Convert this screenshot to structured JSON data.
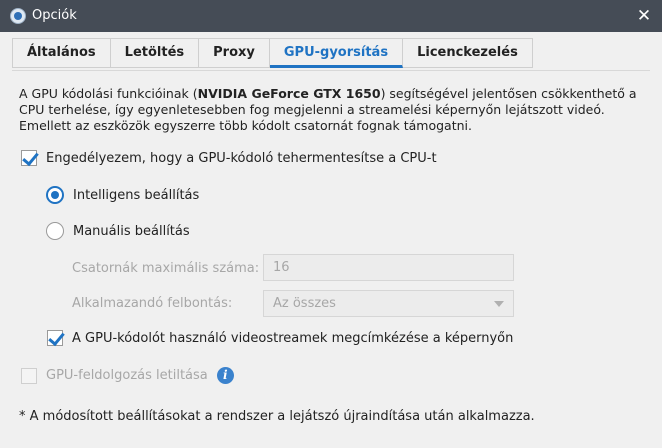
{
  "window": {
    "title": "Opciók"
  },
  "tabs": [
    {
      "label": "Általános"
    },
    {
      "label": "Letöltés"
    },
    {
      "label": "Proxy"
    },
    {
      "label": "GPU-gyorsítás"
    },
    {
      "label": "Licenckezelés"
    }
  ],
  "active_tab": "GPU-gyorsítás",
  "description": {
    "part1": "A GPU kódolási funkcióinak (",
    "gpu_name": "NVIDIA GeForce GTX 1650",
    "part2": ") segítségével jelentősen csökkenthető a CPU terhelése, így egyenletesebben fog megjelenni a streamelési képernyőn lejátszott videó. Emellett az eszközök egyszerre több kódolt csatornát fognak támogatni."
  },
  "enable_gpu": {
    "label": "Engedélyezem, hogy a GPU-kódoló tehermentesítse a CPU-t",
    "checked": true
  },
  "mode_smart": {
    "label": "Intelligens beállítás",
    "selected": true
  },
  "mode_manual": {
    "label": "Manuális beállítás",
    "selected": false
  },
  "max_channels": {
    "label": "Csatornák maximális száma:",
    "value": "16"
  },
  "resolution": {
    "label": "Alkalmazandó felbontás:",
    "value": "Az összes"
  },
  "label_streams": {
    "label": "A GPU-kódolót használó videostreamek megcímkézése a képernyőn",
    "checked": true
  },
  "disable_gpu": {
    "label": "GPU-feldolgozás letiltása",
    "checked": false,
    "disabled": true
  },
  "footnote": "* A módosított beállításokat a rendszer a lejátszó újraindítása után alkalmazza.",
  "colors": {
    "accent": "#1f73c3",
    "titlebar": "#454c56",
    "info": "#3a82cd"
  }
}
